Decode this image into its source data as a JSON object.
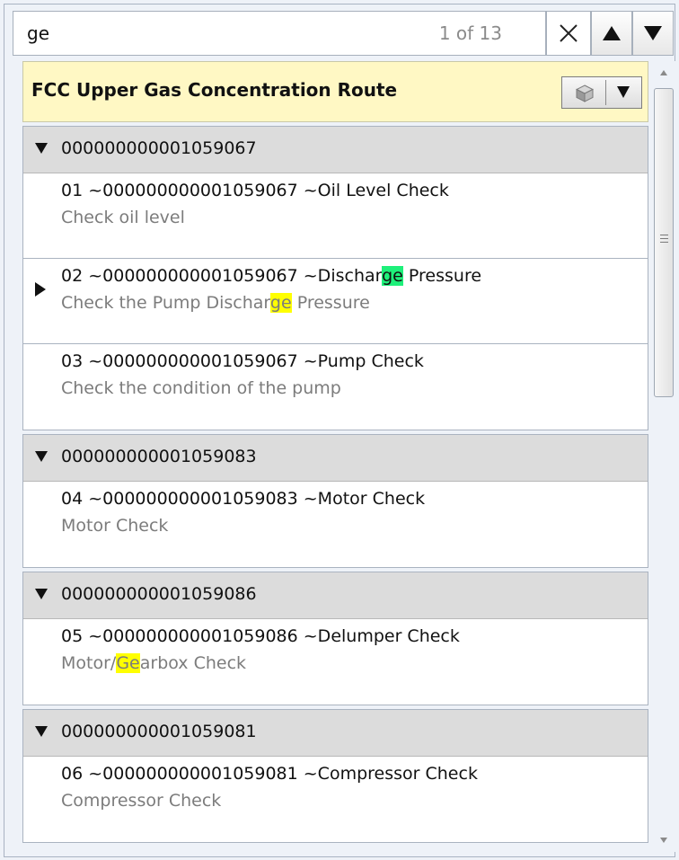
{
  "search": {
    "value": "ge",
    "match_count": "1 of 13",
    "clear_icon": "close-icon",
    "prev_icon": "arrow-up-icon",
    "next_icon": "arrow-down-icon"
  },
  "route": {
    "title": "FCC Upper Gas Concentration Route",
    "header_color": "#fff8c4",
    "button_icon": "cube-icon",
    "dropdown_icon": "dropdown-arrow-icon"
  },
  "highlight_colors": {
    "current": "#1ef07a",
    "other": "#ffff00"
  },
  "groups": [
    {
      "name": "000000000001059067",
      "steps": [
        {
          "title": "01 ~000000000001059067 ~Oil Level Check",
          "desc": "Check oil level"
        },
        {
          "title_pre": "02 ~000000000001059067 ~Dischar",
          "title_hl": "ge",
          "title_post": " Pressure",
          "desc_pre": "Check the Pump Dischar",
          "desc_hl": "ge",
          "desc_post": " Pressure",
          "current": true
        },
        {
          "title": "03 ~000000000001059067 ~Pump Check",
          "desc": "Check the condition of the pump"
        }
      ]
    },
    {
      "name": "000000000001059083",
      "steps": [
        {
          "title": "04 ~000000000001059083 ~Motor Check",
          "desc": "Motor Check"
        }
      ]
    },
    {
      "name": "000000000001059086",
      "steps": [
        {
          "title": "05 ~000000000001059086 ~Delumper Check",
          "desc_pre": "Motor/",
          "desc_hl": "Ge",
          "desc_post": "arbox Check"
        }
      ]
    },
    {
      "name": "000000000001059081",
      "steps": [
        {
          "title": "06 ~000000000001059081 ~Compressor Check",
          "desc": "Compressor Check"
        }
      ]
    }
  ]
}
